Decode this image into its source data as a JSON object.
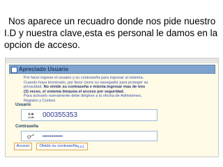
{
  "caption": "Nos aparece un recuadro donde nos pide nuestro I.D y nuestra clave,esta es personal le damos en la opcion de acceso.",
  "login": {
    "title": "Apreciado Usuario",
    "info_lines": [
      "Por favor ingrese el usuario y su contraseña para ingresar al sistema.",
      "Cuando haya terminado, por favor cierre su navegador para proteger su",
      "privacidad. "
    ],
    "info_bold_1": "No olvide su contraseña e intenta ingresar mas de tres",
    "info_bold_2": "(3) veces, el sistema bloquea el acceso por seguridad.",
    "info_line_5": "Para activarlo nuevamente debe dirigirse a la oficina de Admisiones,",
    "info_line_6": "Registro y Control.",
    "user_label": "Usuario",
    "user_value": "000355353",
    "password_label": "Contraseña",
    "password_value": "•••••••••••",
    "access_button": "Acceso",
    "forgot_button": "Olvido su contraseña¿¿¿",
    "user_icon": "users-icon",
    "password_icon": "key-icon"
  },
  "colors": {
    "panel_background": "#fffbe6",
    "title_bar": "#7fa3cf",
    "info_text": "#3a4fb0",
    "button_border": "#e0a040"
  }
}
